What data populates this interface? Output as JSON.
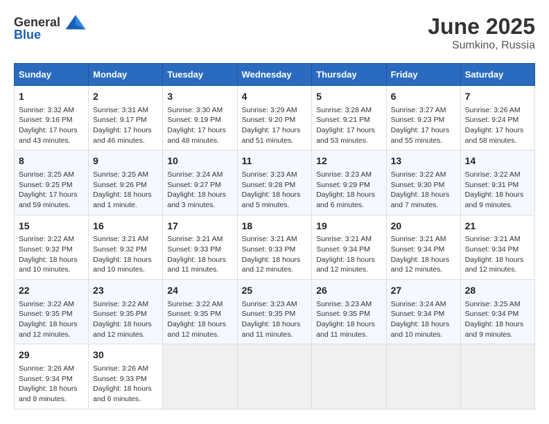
{
  "header": {
    "logo_general": "General",
    "logo_blue": "Blue",
    "month": "June 2025",
    "location": "Sumkino, Russia"
  },
  "weekdays": [
    "Sunday",
    "Monday",
    "Tuesday",
    "Wednesday",
    "Thursday",
    "Friday",
    "Saturday"
  ],
  "weeks": [
    [
      {
        "day": "1",
        "sunrise": "Sunrise: 3:32 AM",
        "sunset": "Sunset: 9:16 PM",
        "daylight": "Daylight: 17 hours and 43 minutes."
      },
      {
        "day": "2",
        "sunrise": "Sunrise: 3:31 AM",
        "sunset": "Sunset: 9:17 PM",
        "daylight": "Daylight: 17 hours and 46 minutes."
      },
      {
        "day": "3",
        "sunrise": "Sunrise: 3:30 AM",
        "sunset": "Sunset: 9:19 PM",
        "daylight": "Daylight: 17 hours and 48 minutes."
      },
      {
        "day": "4",
        "sunrise": "Sunrise: 3:29 AM",
        "sunset": "Sunset: 9:20 PM",
        "daylight": "Daylight: 17 hours and 51 minutes."
      },
      {
        "day": "5",
        "sunrise": "Sunrise: 3:28 AM",
        "sunset": "Sunset: 9:21 PM",
        "daylight": "Daylight: 17 hours and 53 minutes."
      },
      {
        "day": "6",
        "sunrise": "Sunrise: 3:27 AM",
        "sunset": "Sunset: 9:23 PM",
        "daylight": "Daylight: 17 hours and 55 minutes."
      },
      {
        "day": "7",
        "sunrise": "Sunrise: 3:26 AM",
        "sunset": "Sunset: 9:24 PM",
        "daylight": "Daylight: 17 hours and 58 minutes."
      }
    ],
    [
      {
        "day": "8",
        "sunrise": "Sunrise: 3:25 AM",
        "sunset": "Sunset: 9:25 PM",
        "daylight": "Daylight: 17 hours and 59 minutes."
      },
      {
        "day": "9",
        "sunrise": "Sunrise: 3:25 AM",
        "sunset": "Sunset: 9:26 PM",
        "daylight": "Daylight: 18 hours and 1 minute."
      },
      {
        "day": "10",
        "sunrise": "Sunrise: 3:24 AM",
        "sunset": "Sunset: 9:27 PM",
        "daylight": "Daylight: 18 hours and 3 minutes."
      },
      {
        "day": "11",
        "sunrise": "Sunrise: 3:23 AM",
        "sunset": "Sunset: 9:28 PM",
        "daylight": "Daylight: 18 hours and 5 minutes."
      },
      {
        "day": "12",
        "sunrise": "Sunrise: 3:23 AM",
        "sunset": "Sunset: 9:29 PM",
        "daylight": "Daylight: 18 hours and 6 minutes."
      },
      {
        "day": "13",
        "sunrise": "Sunrise: 3:22 AM",
        "sunset": "Sunset: 9:30 PM",
        "daylight": "Daylight: 18 hours and 7 minutes."
      },
      {
        "day": "14",
        "sunrise": "Sunrise: 3:22 AM",
        "sunset": "Sunset: 9:31 PM",
        "daylight": "Daylight: 18 hours and 9 minutes."
      }
    ],
    [
      {
        "day": "15",
        "sunrise": "Sunrise: 3:22 AM",
        "sunset": "Sunset: 9:32 PM",
        "daylight": "Daylight: 18 hours and 10 minutes."
      },
      {
        "day": "16",
        "sunrise": "Sunrise: 3:21 AM",
        "sunset": "Sunset: 9:32 PM",
        "daylight": "Daylight: 18 hours and 10 minutes."
      },
      {
        "day": "17",
        "sunrise": "Sunrise: 3:21 AM",
        "sunset": "Sunset: 9:33 PM",
        "daylight": "Daylight: 18 hours and 11 minutes."
      },
      {
        "day": "18",
        "sunrise": "Sunrise: 3:21 AM",
        "sunset": "Sunset: 9:33 PM",
        "daylight": "Daylight: 18 hours and 12 minutes."
      },
      {
        "day": "19",
        "sunrise": "Sunrise: 3:21 AM",
        "sunset": "Sunset: 9:34 PM",
        "daylight": "Daylight: 18 hours and 12 minutes."
      },
      {
        "day": "20",
        "sunrise": "Sunrise: 3:21 AM",
        "sunset": "Sunset: 9:34 PM",
        "daylight": "Daylight: 18 hours and 12 minutes."
      },
      {
        "day": "21",
        "sunrise": "Sunrise: 3:21 AM",
        "sunset": "Sunset: 9:34 PM",
        "daylight": "Daylight: 18 hours and 12 minutes."
      }
    ],
    [
      {
        "day": "22",
        "sunrise": "Sunrise: 3:22 AM",
        "sunset": "Sunset: 9:35 PM",
        "daylight": "Daylight: 18 hours and 12 minutes."
      },
      {
        "day": "23",
        "sunrise": "Sunrise: 3:22 AM",
        "sunset": "Sunset: 9:35 PM",
        "daylight": "Daylight: 18 hours and 12 minutes."
      },
      {
        "day": "24",
        "sunrise": "Sunrise: 3:22 AM",
        "sunset": "Sunset: 9:35 PM",
        "daylight": "Daylight: 18 hours and 12 minutes."
      },
      {
        "day": "25",
        "sunrise": "Sunrise: 3:23 AM",
        "sunset": "Sunset: 9:35 PM",
        "daylight": "Daylight: 18 hours and 11 minutes."
      },
      {
        "day": "26",
        "sunrise": "Sunrise: 3:23 AM",
        "sunset": "Sunset: 9:35 PM",
        "daylight": "Daylight: 18 hours and 11 minutes."
      },
      {
        "day": "27",
        "sunrise": "Sunrise: 3:24 AM",
        "sunset": "Sunset: 9:34 PM",
        "daylight": "Daylight: 18 hours and 10 minutes."
      },
      {
        "day": "28",
        "sunrise": "Sunrise: 3:25 AM",
        "sunset": "Sunset: 9:34 PM",
        "daylight": "Daylight: 18 hours and 9 minutes."
      }
    ],
    [
      {
        "day": "29",
        "sunrise": "Sunrise: 3:26 AM",
        "sunset": "Sunset: 9:34 PM",
        "daylight": "Daylight: 18 hours and 8 minutes."
      },
      {
        "day": "30",
        "sunrise": "Sunrise: 3:26 AM",
        "sunset": "Sunset: 9:33 PM",
        "daylight": "Daylight: 18 hours and 6 minutes."
      },
      null,
      null,
      null,
      null,
      null
    ]
  ]
}
